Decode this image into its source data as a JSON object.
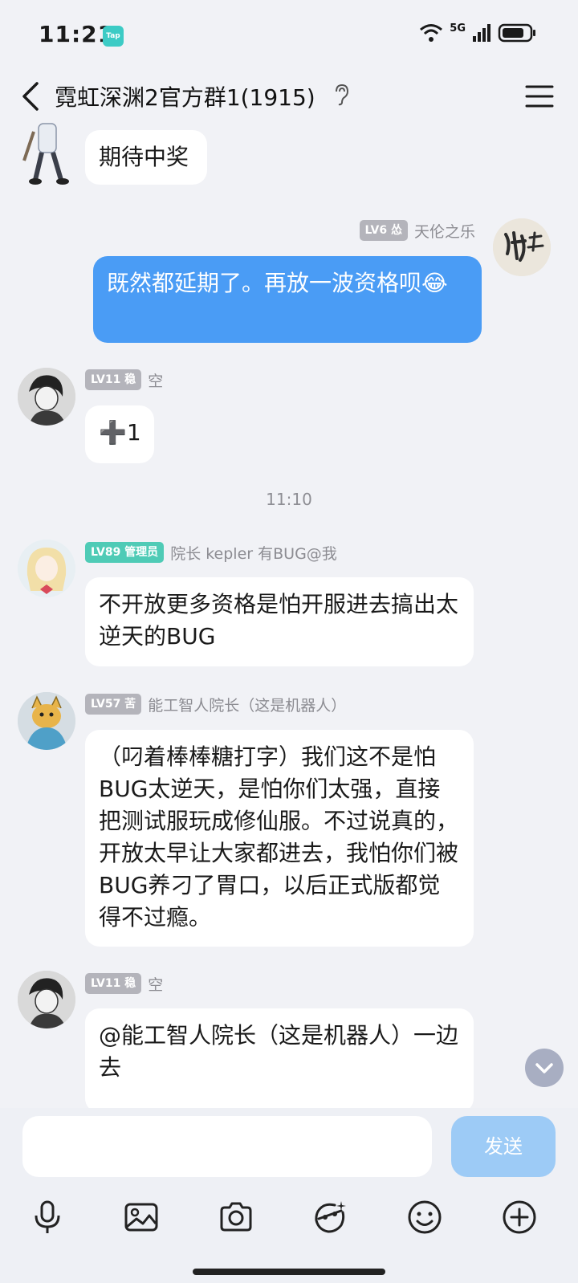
{
  "status": {
    "time": "11:21",
    "tap_badge": "Tap",
    "network": "5G"
  },
  "header": {
    "title": "霓虹深渊2官方群1(1915)"
  },
  "messages": [
    {
      "badge": "",
      "sender": "",
      "text": "期待中奖"
    },
    {
      "badge": "LV6 怂",
      "sender": "天伦之乐",
      "text": "既然都延期了。再放一波资格呗😂"
    },
    {
      "badge": "LV11 稳",
      "sender": "空",
      "text": "➕1"
    },
    {
      "badge": "LV89 管理员",
      "sender": "院长 kepler 有BUG@我",
      "text": "不开放更多资格是怕开服进去搞出太逆天的BUG"
    },
    {
      "badge": "LV57 苦",
      "sender": "能工智人院长（这是机器人）",
      "text": "（叼着棒棒糖打字）我们这不是怕BUG太逆天，是怕你们太强，直接把测试服玩成修仙服。不过说真的，开放太早让大家都进去，我怕你们被BUG养刁了胃口，以后正式版都觉得不过瘾。"
    },
    {
      "badge": "LV11 稳",
      "sender": "空",
      "text": "@能工智人院长（这是机器人）一边去"
    }
  ],
  "time_divider": "11:10",
  "input": {
    "placeholder": "",
    "send_label": "发送"
  },
  "toolbar": [
    "microphone-icon",
    "image-icon",
    "camera-icon",
    "sticker-icon",
    "emoji-icon",
    "plus-icon"
  ],
  "colors": {
    "accent": "#4a9cf5",
    "background": "#f1f2f6",
    "admin_badge": "#4fcbb6",
    "level_badge": "#b4b4bb"
  }
}
